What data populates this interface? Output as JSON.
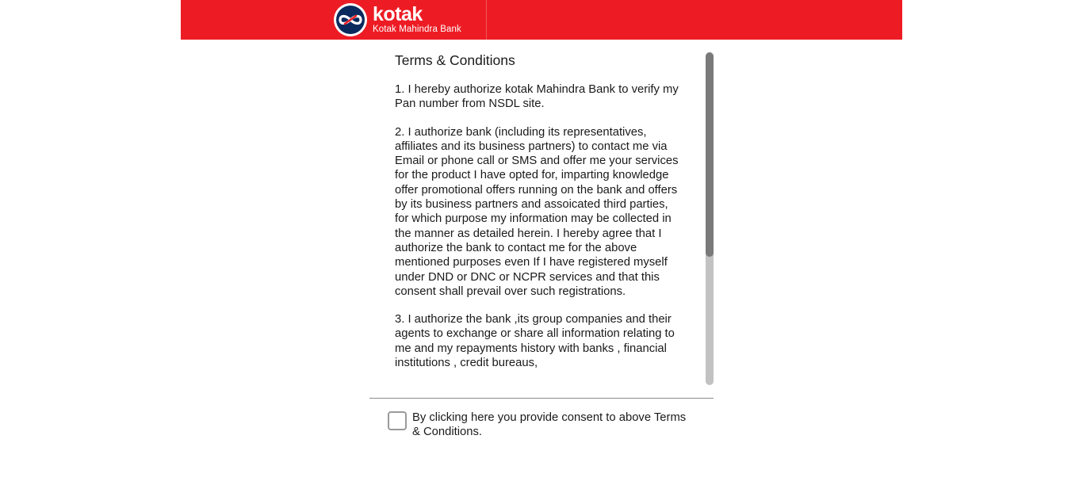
{
  "header": {
    "brand_word": "kotak",
    "brand_sub": "Kotak Mahindra Bank",
    "logo_icon": "kotak-infinity-logo-icon",
    "colors": {
      "brand_red": "#ed1c24",
      "logo_navy": "#0a2a5e"
    }
  },
  "terms": {
    "title": "Terms & Conditions",
    "items": [
      "1. I hereby authorize kotak Mahindra Bank to verify my Pan number from NSDL site.",
      "2. I authorize bank (including its representatives, affiliates and its business partners) to contact me via Email or phone call or SMS and offer me your services for the product I have opted for, imparting knowledge offer promotional offers running on the bank and offers by its business partners and assoicated third parties, for which purpose my information may be collected in the manner as detailed herein. I hereby agree that I authorize the bank to contact me for the above mentioned purposes even If I have registered myself under DND or DNC or NCPR services and that this consent shall prevail over such registrations.",
      "3. I authorize the bank ,its group companies and their agents to exchange or share all information relating to me and my repayments history with banks , financial institutions , credit bureaus,"
    ]
  },
  "consent": {
    "checked": false,
    "label": "By clicking here you provide consent to above Terms & Conditions."
  }
}
